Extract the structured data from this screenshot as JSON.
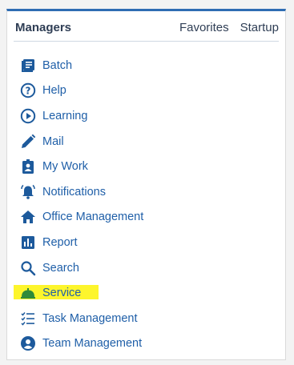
{
  "header": {
    "title": "Managers",
    "tabs": [
      "Favorites",
      "Startup"
    ]
  },
  "colors": {
    "accent": "#2f6db3",
    "link": "#1f5fa8",
    "icon": "#1d5a9c",
    "service_icon": "#2f8a3a",
    "highlight": "#fdf52c"
  },
  "menu": {
    "items": [
      {
        "label": "Batch",
        "icon": "batch-icon"
      },
      {
        "label": "Help",
        "icon": "help-icon"
      },
      {
        "label": "Learning",
        "icon": "play-circle-icon"
      },
      {
        "label": "Mail",
        "icon": "pencil-icon"
      },
      {
        "label": "My Work",
        "icon": "badge-icon"
      },
      {
        "label": "Notifications",
        "icon": "bell-icon"
      },
      {
        "label": "Office Management",
        "icon": "home-icon"
      },
      {
        "label": "Report",
        "icon": "bar-chart-icon"
      },
      {
        "label": "Search",
        "icon": "search-icon"
      },
      {
        "label": "Service",
        "icon": "service-bell-icon",
        "highlighted": true
      },
      {
        "label": "Task Management",
        "icon": "checklist-icon"
      },
      {
        "label": "Team Management",
        "icon": "user-circle-icon"
      }
    ]
  }
}
